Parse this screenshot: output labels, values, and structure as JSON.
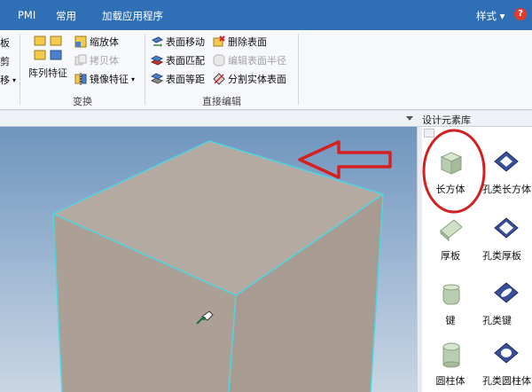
{
  "menubar": {
    "items": [
      "PMI",
      "常用",
      "加载应用程序"
    ],
    "style_menu": "样式",
    "help": "?"
  },
  "ribbon": {
    "left_cut": [
      "板",
      "剪",
      "移"
    ],
    "transform_group": {
      "label": "变换",
      "array_feature": "阵列特征",
      "scale_body": "缩放体",
      "copy_body": "拷贝体",
      "mirror_feature": "镜像特征"
    },
    "direct_edit_group": {
      "label": "直接编辑",
      "face_move": "表面移动",
      "face_match": "表面匹配",
      "face_offset": "表面等距",
      "delete_face": "删除表面",
      "edit_face_radius": "编辑表面半径",
      "split_body_face": "分割实体表面"
    }
  },
  "library": {
    "title": "设计元素库",
    "items": [
      {
        "label": "长方体"
      },
      {
        "label": "孔类长方体"
      },
      {
        "label": "厚板"
      },
      {
        "label": "孔类厚板"
      },
      {
        "label": "键"
      },
      {
        "label": "孔类键"
      },
      {
        "label": "圆柱体"
      },
      {
        "label": "孔类圆柱体"
      }
    ]
  },
  "colors": {
    "menubar": "#2f6fb6",
    "box_face": "#b0a59c",
    "box_edge": "#4fd6e0",
    "annotation": "#d42020"
  }
}
